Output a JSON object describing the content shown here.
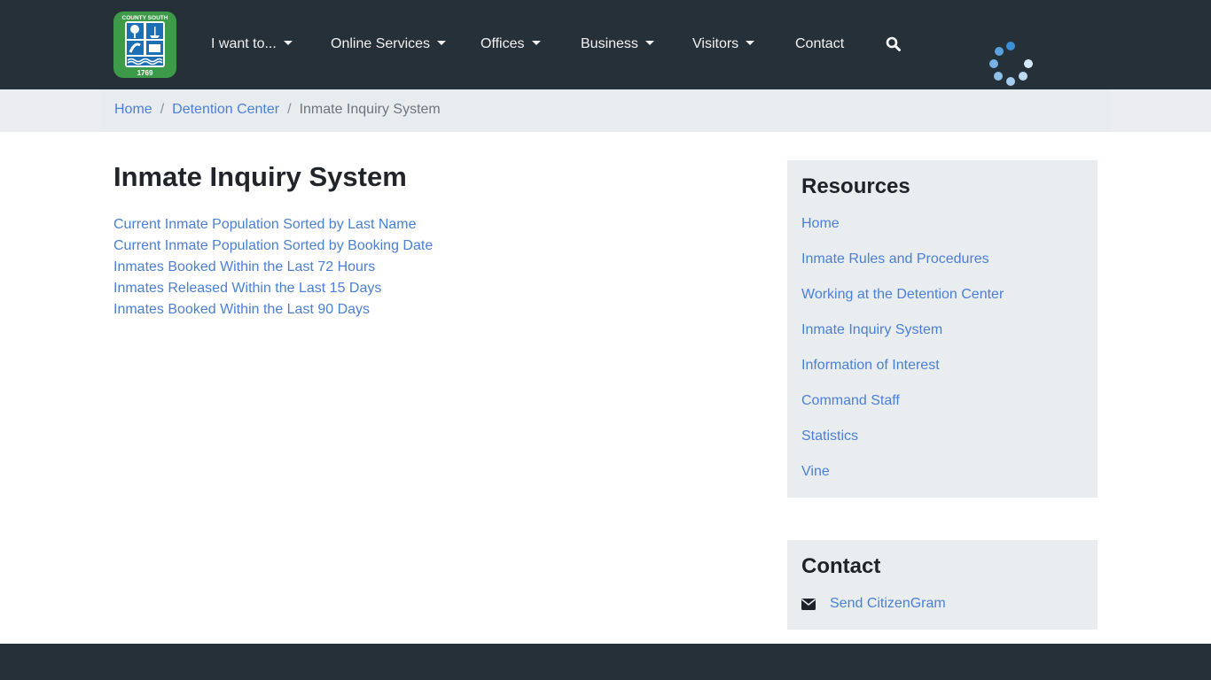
{
  "header": {
    "logo_alt": "Beaufort County South Carolina 1769",
    "logo_text_top": "BEAUFORT COUNTY SOUTH CAROLINA",
    "logo_year": "1769",
    "nav": [
      {
        "label": "I want to...",
        "dropdown": true
      },
      {
        "label": "Online Services",
        "dropdown": true
      },
      {
        "label": "Offices",
        "dropdown": true
      },
      {
        "label": "Business",
        "dropdown": true
      },
      {
        "label": "Visitors",
        "dropdown": true
      },
      {
        "label": "Contact",
        "dropdown": false
      }
    ],
    "search_icon": "search-icon",
    "loading_icon": "loading-spinner-icon"
  },
  "breadcrumb": {
    "items": [
      {
        "label": "Home"
      },
      {
        "label": "Detention Center"
      }
    ],
    "separator": "/",
    "current": "Inmate Inquiry System"
  },
  "main": {
    "title": "Inmate Inquiry System",
    "links": [
      {
        "label": "Current Inmate Population Sorted by Last Name"
      },
      {
        "label": "Current Inmate Population Sorted by Booking Date"
      },
      {
        "label": "Inmates Booked Within the Last 72 Hours"
      },
      {
        "label": "Inmates Released Within the Last 15 Days"
      },
      {
        "label": "Inmates Booked Within the Last 90 Days"
      }
    ]
  },
  "sidebar": {
    "resources": {
      "title": "Resources",
      "items": [
        {
          "label": "Home"
        },
        {
          "label": "Inmate Rules and Procedures"
        },
        {
          "label": "Working at the Detention Center"
        },
        {
          "label": "Inmate Inquiry System"
        },
        {
          "label": "Information of Interest"
        },
        {
          "label": "Command Staff"
        },
        {
          "label": "Statistics"
        },
        {
          "label": "Vine"
        }
      ]
    },
    "contact": {
      "title": "Contact",
      "icon": "envelope-icon",
      "link_label": "Send CitizenGram"
    }
  },
  "colors": {
    "navbar_bg": "#263038",
    "link": "#4a7fd6",
    "card_bg": "#eaedf0",
    "logo_green": "#3d9a48",
    "logo_blue": "#1b6fb5"
  }
}
